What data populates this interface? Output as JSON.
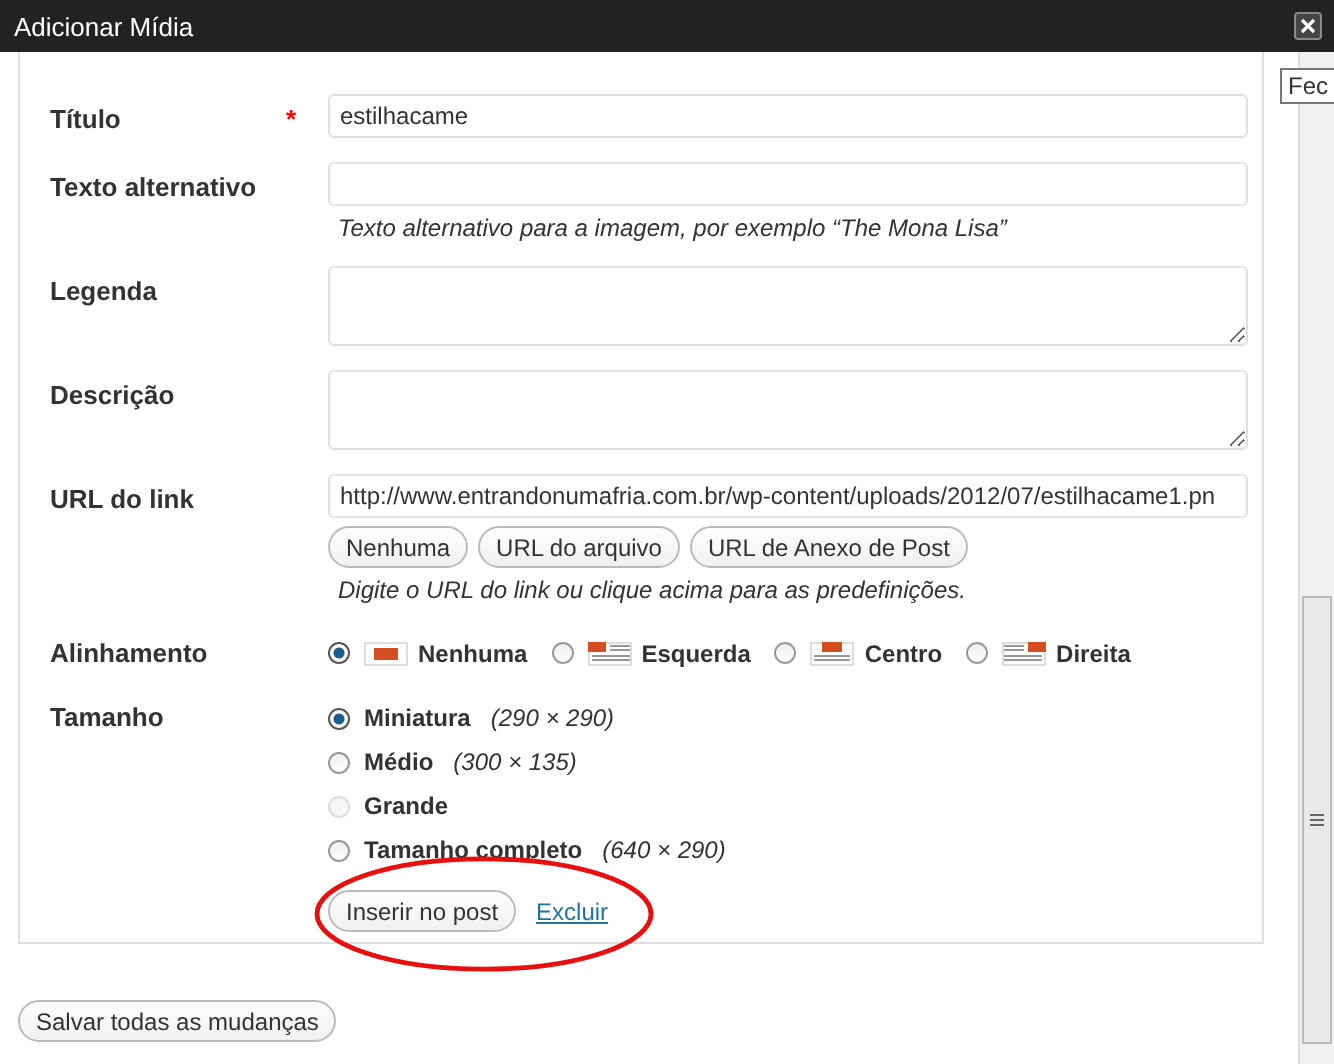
{
  "window": {
    "title": "Adicionar Mídia",
    "tooltip": "Fec"
  },
  "fields": [
    {
      "label": "Título",
      "required_mark": "*",
      "kind": "input",
      "value": "estilhacame"
    },
    {
      "label": "Texto alternativo",
      "kind": "input",
      "help": "Texto alternativo para a imagem, por exemplo “The Mona Lisa”"
    },
    {
      "label": "Legenda",
      "kind": "textarea"
    },
    {
      "label": "Descrição",
      "kind": "textarea"
    },
    {
      "label": "URL do link",
      "kind": "input",
      "value": "http://www.entrandonumafria.com.br/wp-content/uploads/2012/07/estilhacame1.pn",
      "buttons": [
        "Nenhuma",
        "URL do arquivo",
        "URL de Anexo de Post"
      ],
      "help": "Digite o URL do link ou clique acima para as predefinições."
    }
  ],
  "alignment": {
    "label": "Alinhamento",
    "options": [
      {
        "label": "Nenhuma",
        "kind": "none",
        "selected": true
      },
      {
        "label": "Esquerda",
        "kind": "left",
        "selected": false
      },
      {
        "label": "Centro",
        "kind": "center",
        "selected": false
      },
      {
        "label": "Direita",
        "kind": "right",
        "selected": false
      }
    ]
  },
  "size": {
    "label": "Tamanho",
    "options": [
      {
        "label": "Miniatura",
        "dims": "(290 × 290)",
        "selected": true,
        "disabled": false
      },
      {
        "label": "Médio",
        "dims": "(300 × 135)",
        "selected": false,
        "disabled": false
      },
      {
        "label": "Grande",
        "selected": false,
        "disabled": true
      },
      {
        "label": "Tamanho completo",
        "dims": "(640 × 290)",
        "selected": false,
        "disabled": false
      }
    ]
  },
  "insert_button": "Inserir no post",
  "delete_link": "Excluir",
  "save_button": "Salvar todas as mudanças"
}
